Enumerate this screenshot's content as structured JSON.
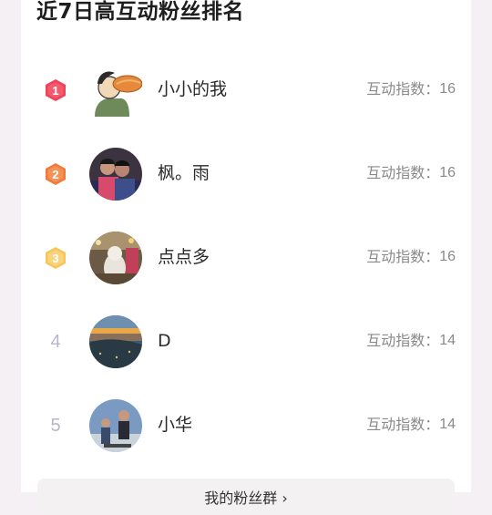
{
  "title": "近7日高互动粉丝排名",
  "score_label": "互动指数：",
  "fans": [
    {
      "rank": "1",
      "name": "小小的我",
      "score": "16"
    },
    {
      "rank": "2",
      "name": "枫。雨",
      "score": "16"
    },
    {
      "rank": "3",
      "name": "点点多",
      "score": "16"
    },
    {
      "rank": "4",
      "name": "D",
      "score": "14"
    },
    {
      "rank": "5",
      "name": "小华",
      "score": "14"
    }
  ],
  "bottom_button": "我的粉丝群 ›",
  "colors": {
    "rank1": "#f0405a",
    "rank2": "#f07a3c",
    "rank3": "#f7c65a",
    "rank_plain": "#b7b7c8"
  }
}
